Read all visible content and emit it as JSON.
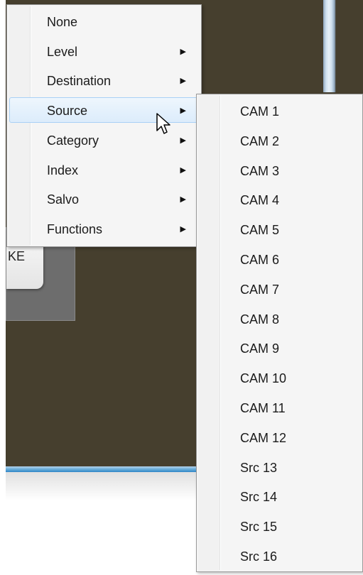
{
  "background_window": {
    "take_button_label": "KE"
  },
  "context_menu": {
    "items": [
      {
        "label": "None",
        "has_submenu": false
      },
      {
        "label": "Level",
        "has_submenu": true
      },
      {
        "label": "Destination",
        "has_submenu": true
      },
      {
        "label": "Source",
        "has_submenu": true,
        "highlighted": true
      },
      {
        "label": "Category",
        "has_submenu": true
      },
      {
        "label": "Index",
        "has_submenu": true
      },
      {
        "label": "Salvo",
        "has_submenu": true
      },
      {
        "label": "Functions",
        "has_submenu": true
      }
    ],
    "submenu_arrow_glyph": "▶"
  },
  "source_submenu": {
    "items": [
      {
        "label": "CAM 1"
      },
      {
        "label": "CAM 2"
      },
      {
        "label": "CAM 3"
      },
      {
        "label": "CAM 4"
      },
      {
        "label": "CAM 5"
      },
      {
        "label": "CAM 6"
      },
      {
        "label": "CAM 7"
      },
      {
        "label": "CAM 8"
      },
      {
        "label": "CAM 9"
      },
      {
        "label": "CAM 10"
      },
      {
        "label": "CAM 11"
      },
      {
        "label": "CAM 12"
      },
      {
        "label": "Src 13"
      },
      {
        "label": "Src 14"
      },
      {
        "label": "Src 15"
      },
      {
        "label": "Src 16"
      }
    ]
  },
  "colors": {
    "window_background": "#463f2e",
    "menu_background": "#f5f5f5",
    "highlight_border": "#a9d0f5",
    "window_border_blue": "#2f86c7"
  },
  "icons": {
    "cursor": "mouse-pointer-icon",
    "submenu_arrow": "chevron-right-icon"
  }
}
